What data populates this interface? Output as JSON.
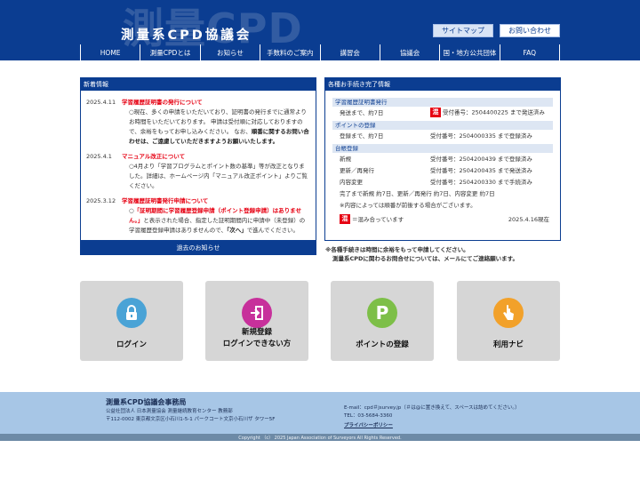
{
  "header": {
    "watermark": "測量CPD",
    "title": "測量系CPD協議会",
    "sitemap_label": "サイトマップ",
    "contact_label": "お問い合わせ",
    "bg_color": "#0b3d91"
  },
  "nav": {
    "items": [
      {
        "label": "HOME"
      },
      {
        "label": "測量CPDとは"
      },
      {
        "label": "お知らせ"
      },
      {
        "label": "手数料のご案内"
      },
      {
        "label": "講習会"
      },
      {
        "label": "協議会"
      },
      {
        "label": "国・地方公共団体"
      },
      {
        "label": "FAQ"
      }
    ]
  },
  "news": {
    "heading": "新着情報",
    "entries": [
      {
        "date": "2025.4.11",
        "title": "学習履歴証明書の発行について",
        "text_1": "○現在、多くの申請をいただいており、証明書の発行までに通常よりお時間をいただいております。 申請は受付順に対応しておりますので、余裕をもってお申し込みください。 なお、",
        "text_strong": "順番に関するお問い合わせは、ご遠慮していただきますようお願いいたします。"
      },
      {
        "date": "2025.4.1",
        "title": "マニュアル改正について",
        "text_1": "○4月より「学習プログラムとポイント数の基準」等が改正となりました。詳細は、ホームページ内「マニュアル改正ポイント」よりご覧ください。"
      },
      {
        "date": "2025.3.12",
        "title": "学習履歴証明書発行申請について",
        "text_red": "「証明期間に学習履歴登録申請（ポイント登録申請）はありません。」",
        "text_2": "と表示された場合、指定した証明期間内に申請中（未登録）の学習履歴登録申請はありませんので、",
        "text_next": "「次へ」",
        "text_3": "で進んでください。"
      }
    ],
    "past_label": "過去のお知らせ"
  },
  "procedures": {
    "heading": "各種お手続き完了情報",
    "congestion_mark": "混",
    "categories": [
      {
        "name": "学習履歴証明書発行",
        "rows": [
          {
            "left": "発送まで、約7日",
            "right": "受付番号：2504400225 まで発送済み",
            "congested": true
          }
        ]
      },
      {
        "name": "ポイントの登録",
        "rows": [
          {
            "left": "登録まで、約7日",
            "right": "受付番号：2504000335 まで登録済み",
            "congested": false
          }
        ]
      },
      {
        "name": "台帳登録",
        "rows": [
          {
            "left": "新規",
            "right": "受付番号：2504200439 まで登録済み",
            "congested": false
          },
          {
            "left": "更新／再発行",
            "right": "受付番号：2504200435 まで発送済み",
            "congested": false
          },
          {
            "left": "内容変更",
            "right": "受付番号：2504200330 まで手続済み",
            "congested": false
          }
        ]
      }
    ],
    "summary": "完了まで新規 約7日、更新／再発行 約7日、内容変更 約7日",
    "order_note": "※内容によっては順番が前後する場合がございます。",
    "congestion_legend": "＝混み合っています",
    "as_of": "2025.4.16現在"
  },
  "notice": {
    "line_1": "※各種手続きは時間に余裕をもって申請してください。",
    "line_2": "測量系CPDに関わるお問合せについては、メールにてご連絡願います。"
  },
  "tiles": [
    {
      "label_1": "ログイン",
      "label_2": "",
      "icon": "lock-icon",
      "color": "#4aa3d6"
    },
    {
      "label_1": "新規登録",
      "label_2": "ログインできない方",
      "icon": "signin-icon",
      "color": "#c7309b"
    },
    {
      "label_1": "ポイントの登録",
      "label_2": "",
      "icon": "p-icon",
      "color": "#7dbf48"
    },
    {
      "label_1": "利用ナビ",
      "label_2": "",
      "icon": "pointer-icon",
      "color": "#f2a12a"
    }
  ],
  "footer": {
    "office": "測量系CPD協議会事務局",
    "org": "公益社団法人 日本測量協会 測量継続教育センター 教務部",
    "address": "〒112-0002 東京都文京区小石川1-5-1 パークコート文京小石川ザ タワー5F",
    "email": "E-mail：cpd＃jsurvey.jp（＃は@に置き換えて、スペースは詰めてください。）",
    "tel": "TEL：03-5684-3360",
    "privacy": "プライバシーポリシー",
    "copyright": "Copyright （c） 2025 Japan Association of Surveyors All Rights Reserved."
  }
}
